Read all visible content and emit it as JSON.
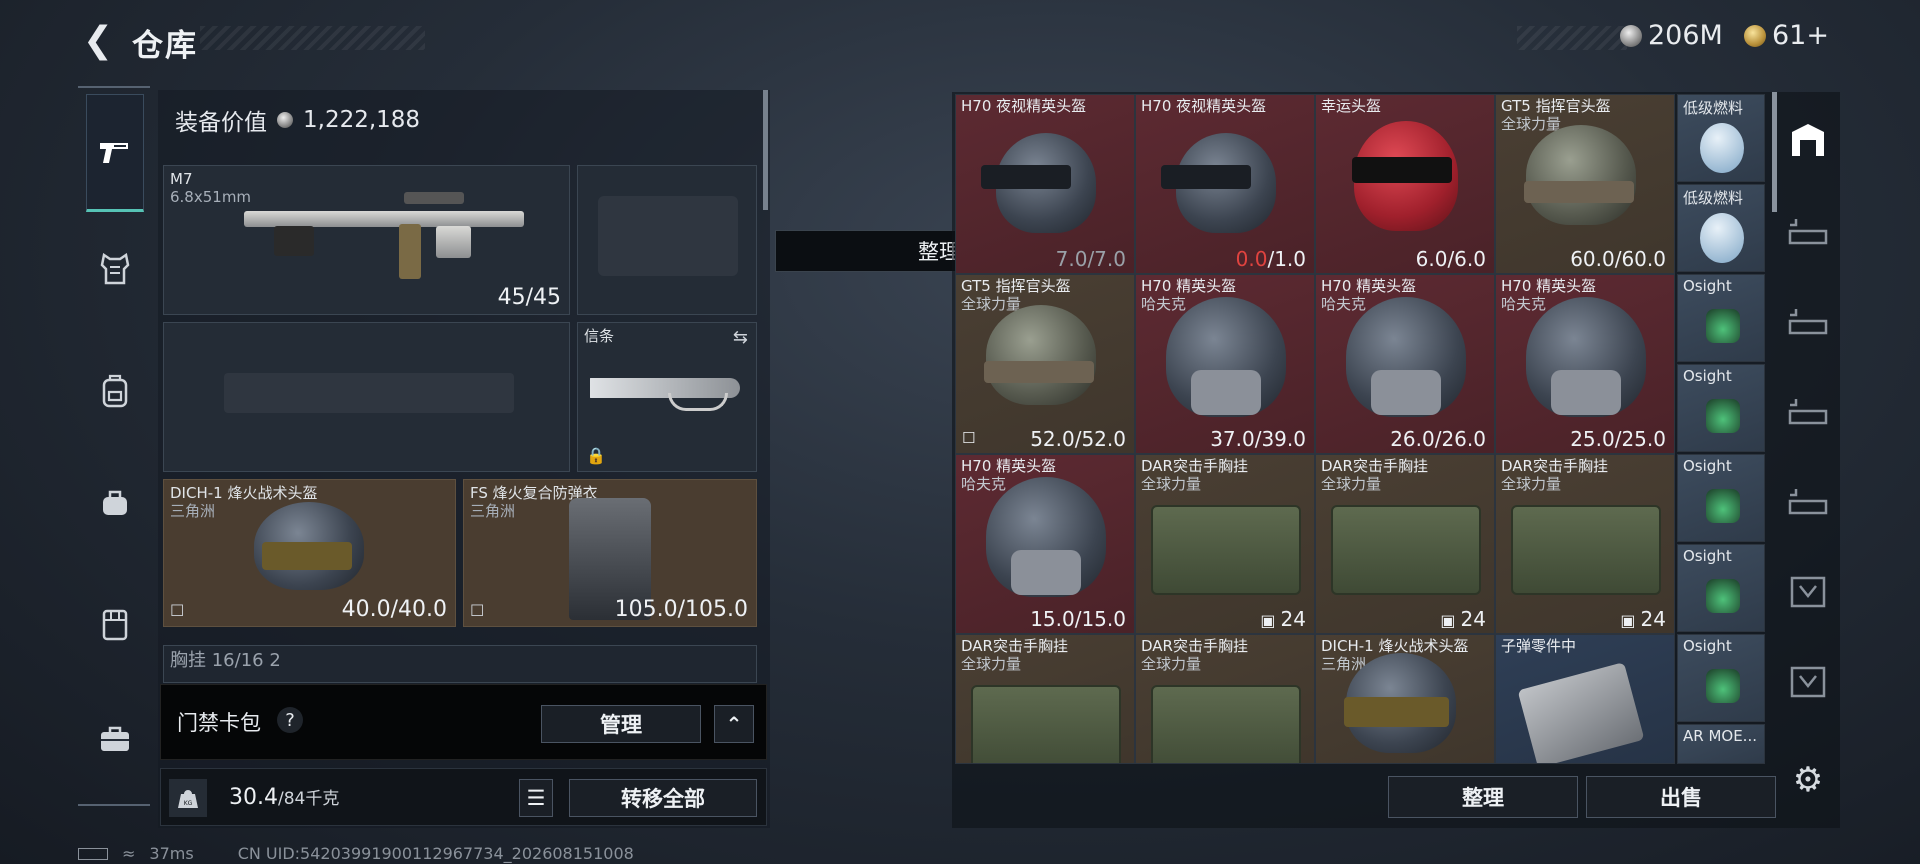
{
  "header": {
    "title": "仓库",
    "currency_silver": "206M",
    "currency_gold": "61+"
  },
  "left_nav": {
    "items": [
      "weapon-icon",
      "armor-vest-icon",
      "backpack-icon",
      "bag-icon",
      "rig-icon",
      "case-icon"
    ]
  },
  "equipment": {
    "value_label": "装备价值",
    "value": "1,222,188",
    "primary": {
      "name": "M7",
      "ammo": "6.8x51mm",
      "durability": "45/45"
    },
    "melee": {
      "label": "信条"
    },
    "helmet": {
      "name": "DICH-1 烽火战术头盔",
      "origin": "三角洲",
      "durability": "40.0/40.0"
    },
    "armor": {
      "name": "FS 烽火复合防弹衣",
      "origin": "三角洲",
      "durability": "105.0/105.0"
    },
    "chest_rig_partial": "胸挂 16/16 2"
  },
  "card_pack": {
    "label": "门禁卡包",
    "help": "?",
    "manage_button": "管理",
    "expand": "^"
  },
  "weight": {
    "current": "30.4",
    "max": "/84千克",
    "transfer_all_button": "转移全部"
  },
  "status": {
    "ping": "37ms",
    "uid": "CN UID:54203991900112967734_202608151008"
  },
  "toast": "整理成功",
  "grid": {
    "cells": [
      {
        "name": "H70 夜视精英头盔",
        "sub": "",
        "value": "7.0/7.0"
      },
      {
        "name": "H70 夜视精英头盔",
        "sub": "",
        "value_red": "0.0",
        "value": "/1.0"
      },
      {
        "name": "幸运头盔",
        "sub": "",
        "value": "6.0/6.0"
      },
      {
        "name": "GT5 指挥官头盔",
        "sub": "全球力量",
        "value": "60.0/60.0"
      },
      {
        "name": "GT5 指挥官头盔",
        "sub": "全球力量",
        "value": "52.0/52.0"
      },
      {
        "name": "H70 精英头盔",
        "sub": "哈夫克",
        "value": "37.0/39.0"
      },
      {
        "name": "H70 精英头盔",
        "sub": "哈夫克",
        "value": "26.0/26.0"
      },
      {
        "name": "H70 精英头盔",
        "sub": "哈夫克",
        "value": "25.0/25.0"
      },
      {
        "name": "H70 精英头盔",
        "sub": "哈夫克",
        "value": "15.0/15.0"
      },
      {
        "name": "DAR突击手胸挂",
        "sub": "全球力量",
        "value": "24"
      },
      {
        "name": "DAR突击手胸挂",
        "sub": "全球力量",
        "value": "24"
      },
      {
        "name": "DAR突击手胸挂",
        "sub": "全球力量",
        "value": "24"
      },
      {
        "name": "DAR突击手胸挂",
        "sub": "全球力量",
        "value": ""
      },
      {
        "name": "DAR突击手胸挂",
        "sub": "全球力量",
        "value": ""
      },
      {
        "name": "DICH-1 烽火战术头盔",
        "sub": "三角洲",
        "value": ""
      },
      {
        "name": "子弹零件中",
        "sub": "",
        "value": ""
      }
    ],
    "small_items": [
      "低级燃料",
      "低级燃料",
      "Osight",
      "Osight",
      "Osight",
      "Osight",
      "Osight",
      "AR MOE..."
    ]
  },
  "actions": {
    "sort_button": "整理",
    "sell_button": "出售"
  },
  "colors": {
    "accent_teal": "#56c3b5",
    "cell_red": "#5d2a32",
    "cell_brown": "#4a3f33",
    "cell_blue": "#2f3f56",
    "warning_red": "#e0433f"
  }
}
